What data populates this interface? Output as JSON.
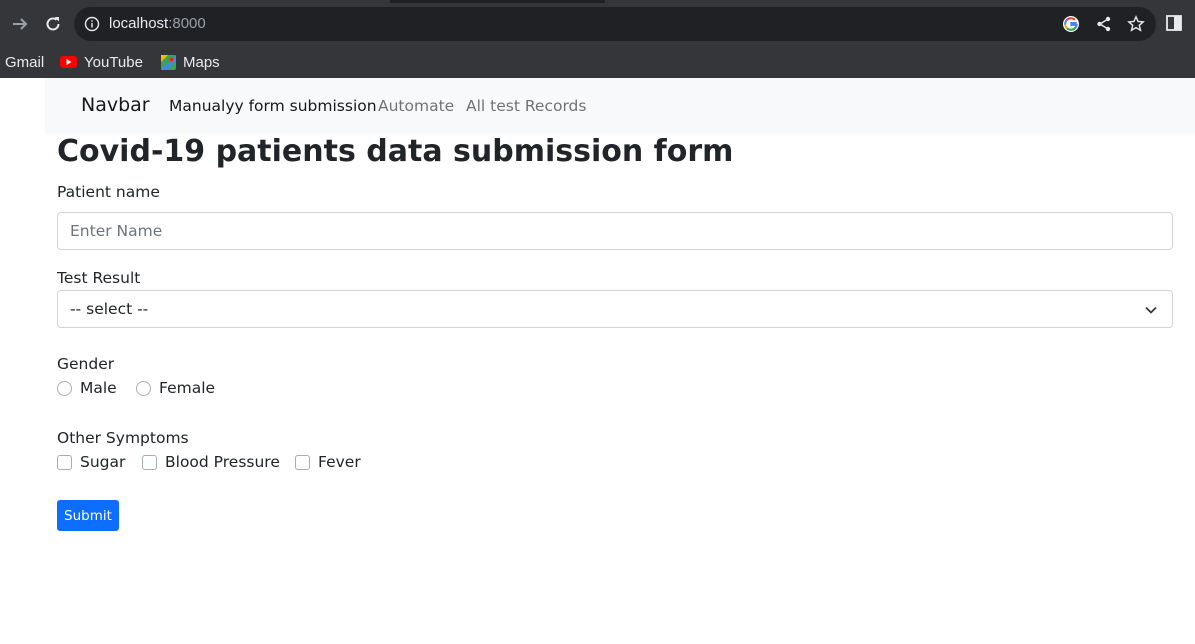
{
  "browser": {
    "url_host": "localhost",
    "url_port": ":8000",
    "bookmarks": [
      {
        "label": "Gmail"
      },
      {
        "label": "YouTube"
      },
      {
        "label": "Maps"
      }
    ]
  },
  "navbar": {
    "brand": "Navbar",
    "links": [
      {
        "label": "Manualyy form submission",
        "active": true
      },
      {
        "label": "Automate",
        "active": false
      },
      {
        "label": "All test Records",
        "active": false
      }
    ]
  },
  "form": {
    "title": "Covid-19 patients data submission form",
    "patient_name": {
      "label": "Patient name",
      "placeholder": "Enter Name",
      "value": ""
    },
    "test_result": {
      "label": "Test Result",
      "selected": "-- select --"
    },
    "gender": {
      "label": "Gender",
      "options": [
        "Male",
        "Female"
      ]
    },
    "symptoms": {
      "label": "Other Symptoms",
      "options": [
        "Sugar",
        "Blood Pressure",
        "Fever"
      ]
    },
    "submit_label": "Submit"
  },
  "colors": {
    "chrome_bg": "#35363a",
    "omnibox_bg": "#202124",
    "navbar_bg": "#f8f9fa",
    "primary": "#0d6efd"
  }
}
